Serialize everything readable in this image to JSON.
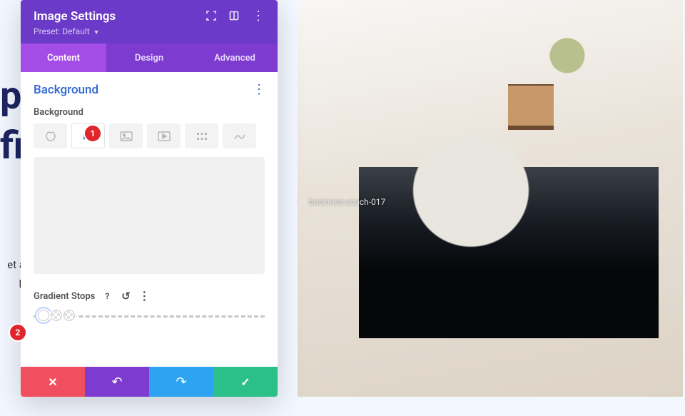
{
  "bg_text_top": "p\nfi",
  "bg_text_bottom": "et a\nb",
  "panel": {
    "title": "Image Settings",
    "preset_label": "Preset: Default",
    "tabs": {
      "content": "Content",
      "design": "Design",
      "advanced": "Advanced"
    },
    "section_title": "Background",
    "field_label": "Background",
    "gradient_stops_label": "Gradient Stops",
    "help_glyph": "?",
    "reset_glyph": "↺",
    "kebab_glyph": "⋮"
  },
  "preview": {
    "placeholder_label": "business-coach-017"
  },
  "markers": {
    "m1": "1",
    "m2": "2"
  }
}
